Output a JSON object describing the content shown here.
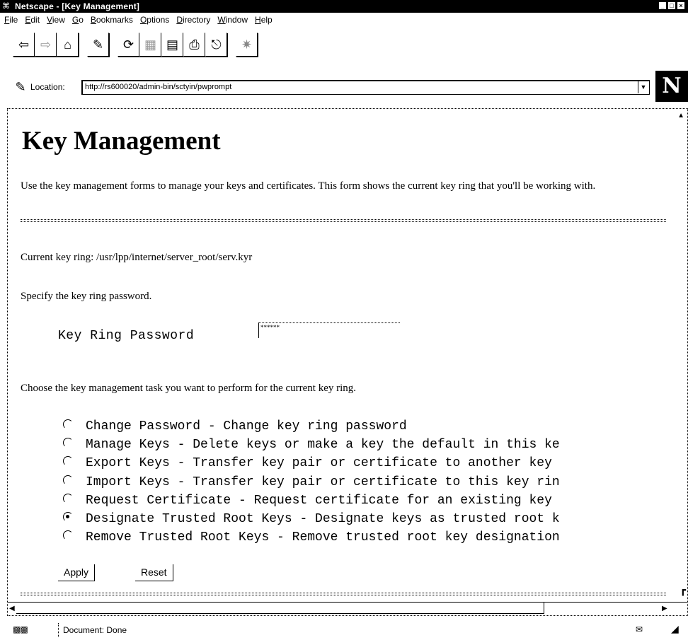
{
  "window": {
    "title": "Netscape - [Key Management]",
    "controls": [
      "_",
      "□",
      "×"
    ]
  },
  "menu": [
    "File",
    "Edit",
    "View",
    "Go",
    "Bookmarks",
    "Options",
    "Directory",
    "Window",
    "Help"
  ],
  "toolbar": {
    "icons": [
      "back-icon",
      "forward-icon",
      "home-icon",
      "edit-icon",
      "reload-icon",
      "images-icon",
      "open-icon",
      "print-icon",
      "find-icon",
      "stop-icon"
    ]
  },
  "location": {
    "label": "Location:",
    "url": "http://rs600020/admin-bin/sctyin/pwprompt",
    "logo": "N"
  },
  "page": {
    "title": "Key Management",
    "intro": "Use the key management forms to manage your keys and certificates. This form shows the current key ring that you'll be working with.",
    "current_ring": "Current key ring: /usr/lpp/internet/server_root/serv.kyr",
    "specify": "Specify the key ring password.",
    "password_label": "Key Ring Password",
    "password_value": "******",
    "choose": "Choose the key management task you want to perform for the current key ring.",
    "tasks": [
      {
        "label": "Change Password - Change key ring password",
        "checked": false
      },
      {
        "label": "Manage Keys - Delete keys or make a key the default in this ke",
        "checked": false
      },
      {
        "label": "Export Keys - Transfer key pair or certificate to another key",
        "checked": false
      },
      {
        "label": "Import Keys - Transfer key pair or certificate to this key rin",
        "checked": false
      },
      {
        "label": "Request Certificate - Request certificate for an existing key",
        "checked": false
      },
      {
        "label": "Designate Trusted Root Keys - Designate keys as trusted root k",
        "checked": true
      },
      {
        "label": "Remove Trusted Root Keys - Remove trusted root key designation",
        "checked": false
      }
    ],
    "apply_label": "Apply",
    "reset_label": "Reset"
  },
  "status": {
    "text": "Document: Done"
  }
}
